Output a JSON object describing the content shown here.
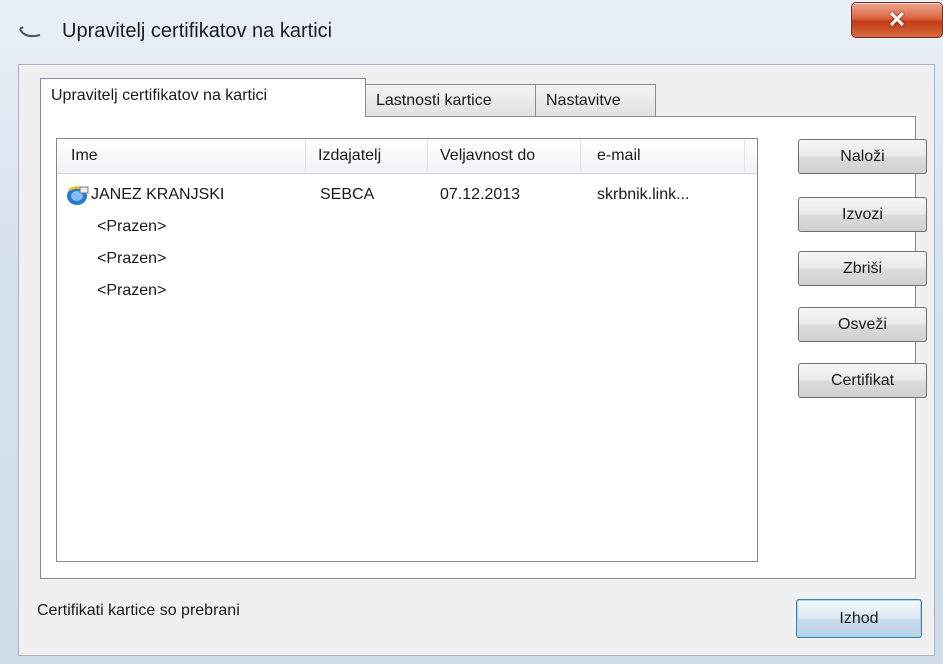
{
  "window": {
    "title": "Upravitelj certifikatov na kartici",
    "close_icon": "close-icon"
  },
  "tabs": [
    {
      "label": "Upravitelj certifikatov na kartici",
      "active": true
    },
    {
      "label": "Lastnosti kartice",
      "active": false
    },
    {
      "label": "Nastavitve",
      "active": false
    }
  ],
  "list": {
    "columns": [
      "Ime",
      "Izdajatelj",
      "Veljavnost do",
      "e-mail"
    ],
    "rows": [
      {
        "ime": "JANEZ KRANJSKI",
        "izdajatelj": "SEBCA",
        "veljavnost": "07.12.2013",
        "email": "skrbnik.link...",
        "icon": "certificate-icon"
      },
      {
        "ime": "<Prazen>"
      },
      {
        "ime": "<Prazen>"
      },
      {
        "ime": "<Prazen>"
      }
    ]
  },
  "buttons": {
    "nalozi": "Naloži",
    "izvozi": "Izvozi",
    "zbrisi": "Zbriši",
    "osvezi": "Osveži",
    "certifikat": "Certifikat",
    "izhod": "Izhod"
  },
  "status": "Certifikati kartice so prebrani"
}
